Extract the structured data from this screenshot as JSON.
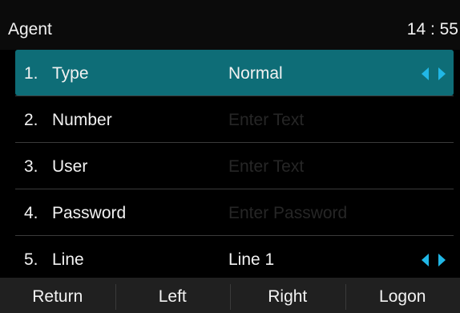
{
  "header": {
    "title": "Agent",
    "time": "14 : 55"
  },
  "rows": [
    {
      "num": "1.",
      "label": "Type",
      "value": "Normal",
      "placeholder": "",
      "has_arrows": true
    },
    {
      "num": "2.",
      "label": "Number",
      "value": "",
      "placeholder": "Enter Text",
      "has_arrows": false
    },
    {
      "num": "3.",
      "label": "User",
      "value": "",
      "placeholder": "Enter Text",
      "has_arrows": false
    },
    {
      "num": "4.",
      "label": "Password",
      "value": "",
      "placeholder": "Enter Password",
      "has_arrows": false
    },
    {
      "num": "5.",
      "label": "Line",
      "value": "Line 1",
      "placeholder": "",
      "has_arrows": true
    }
  ],
  "softkeys": [
    "Return",
    "Left",
    "Right",
    "Logon"
  ],
  "colors": {
    "selection": "#0e6d77",
    "arrow": "#21b7e6",
    "softkey_bar": "#202020"
  },
  "icons": {
    "selector_arrows": "left-right-arrows-icon"
  }
}
